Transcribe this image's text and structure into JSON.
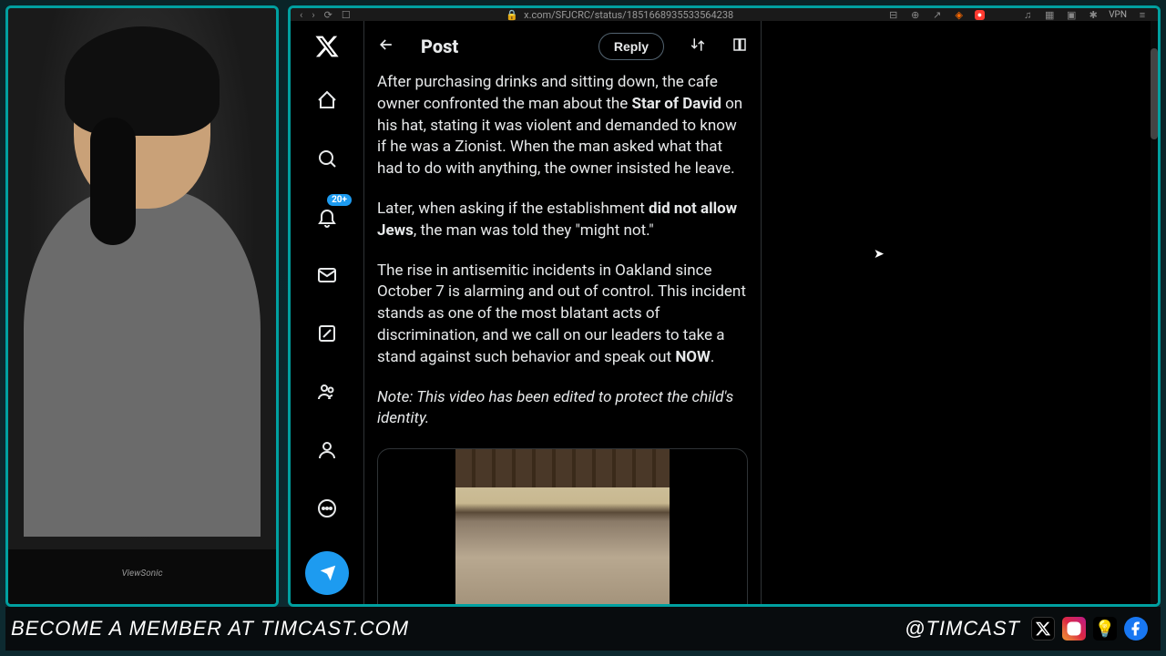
{
  "browser": {
    "url": "x.com/SFJCRC/status/1851668935533564238",
    "vpn_label": "VPN"
  },
  "sidebar": {
    "notification_badge": "20+"
  },
  "header": {
    "title": "Post",
    "reply_label": "Reply"
  },
  "post": {
    "p1_a": "After purchasing drinks and sitting down, the cafe owner confronted the man about the ",
    "p1_b": "Star of David",
    "p1_c": " on his hat, stating it was violent and demanded to know if he was a Zionist. When the man asked what that had to do with anything, the owner insisted he leave.",
    "p2_a": "Later, when asking if the establishment ",
    "p2_b": "did not allow Jews",
    "p2_c": ", the man was told they \"might not.\"",
    "p3_a": "The rise in antisemitic incidents in Oakland since October 7 is alarming and out of control. This incident stands as one of the most blatant acts of discrimination, and we call on our leaders to take a stand against such behavior and speak out ",
    "p3_b": "NOW",
    "p3_c": ".",
    "note": "Note: This video has been edited to protect the child's identity."
  },
  "webcam": {
    "monitor_brand": "ViewSonic"
  },
  "footer": {
    "cta_prefix": "BECOME A MEMBER AT ",
    "cta_domain": "TIMCAST.COM",
    "handle": "@TIMCAST"
  }
}
